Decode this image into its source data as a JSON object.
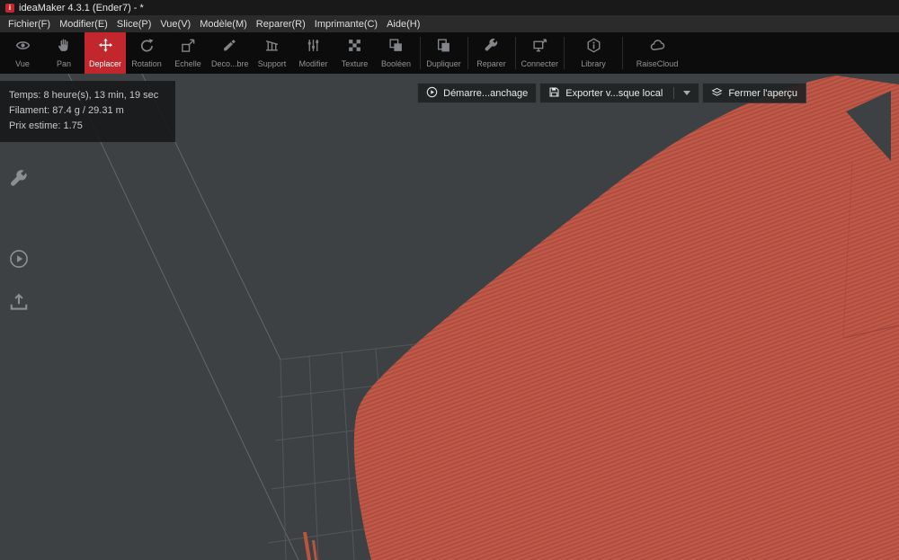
{
  "window": {
    "title": "ideaMaker 4.3.1 (Ender7) - *",
    "app_icon_glyph": "i"
  },
  "menu": {
    "items": [
      {
        "label": "Fichier(F)"
      },
      {
        "label": "Modifier(E)"
      },
      {
        "label": "Slice(P)"
      },
      {
        "label": "Vue(V)"
      },
      {
        "label": "Modèle(M)"
      },
      {
        "label": "Reparer(R)"
      },
      {
        "label": "Imprimante(C)"
      },
      {
        "label": "Aide(H)"
      }
    ]
  },
  "toolbar": {
    "items": [
      {
        "label": "Vue",
        "icon": "eye-icon",
        "selected": false
      },
      {
        "label": "Pan",
        "icon": "hand-icon",
        "selected": false
      },
      {
        "label": "Deplacer",
        "icon": "move-icon",
        "selected": true
      },
      {
        "label": "Rotation",
        "icon": "rotate-icon",
        "selected": false
      },
      {
        "label": "Echelle",
        "icon": "scale-icon",
        "selected": false
      },
      {
        "label": "Deco...bre",
        "icon": "freecut-icon",
        "selected": false
      },
      {
        "label": "Support",
        "icon": "support-icon",
        "selected": false
      },
      {
        "label": "Modifier",
        "icon": "sliders-icon",
        "selected": false
      },
      {
        "label": "Texture",
        "icon": "texture-icon",
        "selected": false
      },
      {
        "label": "Booléen",
        "icon": "boolean-icon",
        "selected": false
      },
      {
        "label": "Dupliquer",
        "icon": "duplicate-icon",
        "selected": false
      },
      {
        "label": "Reparer",
        "icon": "wrench-icon",
        "selected": false
      },
      {
        "label": "Connecter",
        "icon": "connect-icon",
        "selected": false
      },
      {
        "label": "Library",
        "icon": "library-icon",
        "selected": false
      },
      {
        "label": "RaiseCloud",
        "icon": "cloud-icon",
        "selected": false
      }
    ]
  },
  "stats_panel": {
    "time": "Temps: 8 heure(s), 13 min, 19 sec",
    "filament": "Filament: 87.4 g / 29.31 m",
    "price": "Prix estime: 1.75"
  },
  "preview_actions": {
    "start_label": "Démarre...anchage",
    "export_label": "Exporter v...sque local",
    "close_label": "Fermer l'aperçu"
  },
  "side_tools": {
    "settings": "settings-wrench",
    "start": "start-print",
    "export": "export-upload"
  },
  "colors": {
    "accent_red": "#c1272d",
    "model_base": "#c05848",
    "model_layer": "#a74a3c",
    "viewport_bg": "#3e4144",
    "toolbar_bg": "#0c0c0c"
  }
}
